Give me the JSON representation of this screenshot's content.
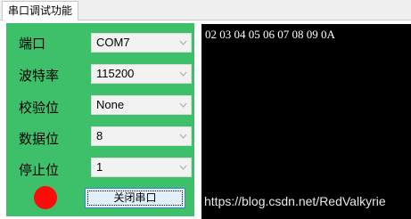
{
  "tab": {
    "label": "串口调试功能"
  },
  "settings": {
    "port": {
      "label": "端口",
      "value": "COM7"
    },
    "baudrate": {
      "label": "波特率",
      "value": "115200"
    },
    "parity": {
      "label": "校验位",
      "value": "None"
    },
    "databits": {
      "label": "数据位",
      "value": "8"
    },
    "stopbits": {
      "label": "停止位",
      "value": "1"
    }
  },
  "status": {
    "indicator_color": "#ff0a0a"
  },
  "button": {
    "close_port_label": "关闭串口"
  },
  "receive": {
    "text": "02 03 04 05 06 07 08 09 0A"
  },
  "watermark": "https://blog.csdn.net/RedValkyrie",
  "colors": {
    "panel_bg": "#3ec06a",
    "terminal_bg": "#000000",
    "button_bg": "#e1f0fb"
  }
}
